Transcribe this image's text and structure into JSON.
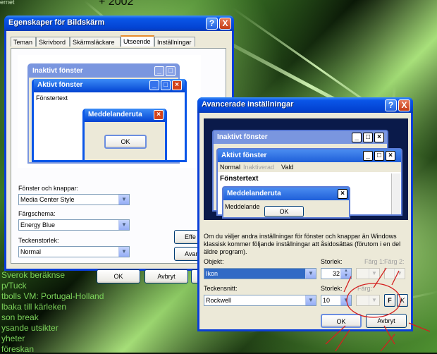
{
  "desktop": {
    "top_text_left": "ernet",
    "top_text_right": "+ 2002",
    "list": [
      "Sverok beräknse",
      "p/Tuck",
      "tbolls VM: Portugal-Holland",
      "lbaka till kärleken",
      "son break",
      "ysande utsikter",
      "yheter",
      "föreskan"
    ]
  },
  "props": {
    "title": "Egenskaper för Bildskärm",
    "help": "?",
    "close": "X",
    "tabs": [
      "Teman",
      "Skrivbord",
      "Skärmsläckare",
      "Utseende",
      "Inställningar"
    ],
    "active_tab": "Utseende",
    "preview": {
      "inactive_title": "Inaktivt fönster",
      "active_title": "Aktivt fönster",
      "window_text": "Fönstertext",
      "msg_title": "Meddelanderuta",
      "ok": "OK"
    },
    "windows_buttons_label": "Fönster och knappar:",
    "windows_buttons_value": "Media Center Style",
    "color_scheme_label": "Färgschema:",
    "color_scheme_value": "Energy Blue",
    "font_size_label": "Teckenstorlek:",
    "font_size_value": "Normal",
    "effects_button": "Effe",
    "advanced_button": "Avan",
    "ok": "OK",
    "cancel": "Avbryt"
  },
  "adv": {
    "title": "Avancerade inställningar",
    "help": "?",
    "close": "X",
    "preview": {
      "inactive_title": "Inaktivt fönster",
      "active_title": "Aktivt fönster",
      "menu_normal": "Normal",
      "menu_disabled": "Inaktiverad",
      "menu_selected": "Vald",
      "window_text": "Fönstertext",
      "msg_title": "Meddelanderuta",
      "msg_text": "Meddelande",
      "ok": "OK"
    },
    "info_text": "Om du väljer andra inställningar för fönster och knappar än Windows klassisk kommer följande inställningar att åsidosättas (förutom i en del äldre program).",
    "object_label": "Objekt:",
    "object_value": "Ikon",
    "size_label": "Storlek:",
    "size_value": "32",
    "color1_label": "Färg 1:",
    "color2_label": "Färg 2:",
    "font_label": "Teckensnitt:",
    "font_value": "Rockwell",
    "font_size_label": "Storlek:",
    "font_size_value": "10",
    "color_label": "Färg:",
    "bold": "F",
    "italic": "K",
    "ok": "OK",
    "cancel": "Avbryt",
    "annotation_color": "#d42020"
  },
  "colors": {
    "xp_blue": "#0a56e8",
    "dialog_bg": "#ece9d8",
    "preview_inactive": "#7a96df",
    "preview_desktop": "#0a1a4a"
  }
}
